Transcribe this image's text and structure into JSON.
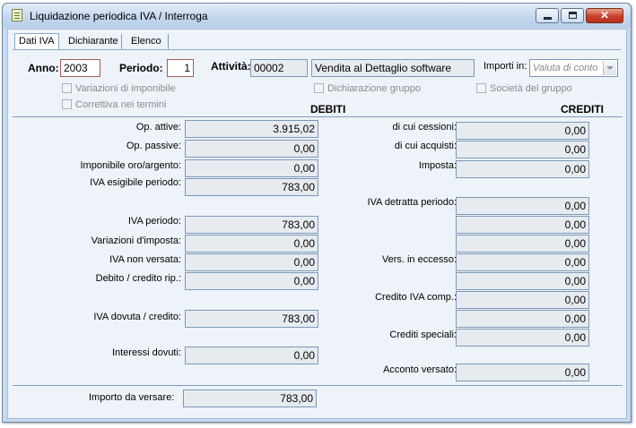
{
  "window": {
    "title": "Liquidazione periodica IVA / Interroga",
    "icon": "document-list-icon",
    "buttons": [
      "minimize",
      "maximize",
      "close"
    ]
  },
  "tabs": [
    "Dati IVA",
    "Dichiarante",
    "Elenco"
  ],
  "header": {
    "anno_label": "Anno:",
    "anno_value": "2003",
    "periodo_label": "Periodo:",
    "periodo_value": "1",
    "attivita_label": "Attività:",
    "attivita_code": "00002",
    "attivita_desc": "Vendita al Dettaglio software",
    "importi_label": "Importi in:",
    "importi_value": "Valuta di conto"
  },
  "checkboxes": {
    "variazioni_imponibile": "Variazioni di imponibile",
    "correttiva": "Correttiva nei termini",
    "dichiarazione_gruppo": "Dichiarazione gruppo",
    "societa_gruppo": "Società del gruppo"
  },
  "columns": {
    "debiti": "DEBITI",
    "crediti": "CREDITI"
  },
  "left": {
    "op_attive_label": "Op. attive:",
    "op_attive_value": "3.915,02",
    "op_passive_label": "Op. passive:",
    "op_passive_value": "0,00",
    "imponibile_oro_label": "Imponibile oro/argento:",
    "imponibile_oro_value": "0,00",
    "iva_esigibile_label": "IVA esigibile periodo:",
    "iva_esigibile_value": "783,00",
    "iva_periodo_label": "IVA periodo:",
    "iva_periodo_value": "783,00",
    "variazioni_imposta_label": "Variazioni d'imposta:",
    "variazioni_imposta_value": "0,00",
    "iva_non_versata_label": "IVA non versata:",
    "iva_non_versata_value": "0,00",
    "debito_credito_label": "Debito / credito rip.:",
    "debito_credito_value": "0,00",
    "iva_dovuta_label": "IVA dovuta / credito:",
    "iva_dovuta_value": "783,00",
    "interessi_label": "Interessi dovuti:",
    "interessi_value": "0,00"
  },
  "right": {
    "cessioni_label": "di cui cessioni:",
    "cessioni_value": "0,00",
    "acquisti_label": "di cui acquisti:",
    "acquisti_value": "0,00",
    "imposta_label": "Imposta:",
    "imposta_value": "0,00",
    "iva_detratta_label": "IVA detratta periodo:",
    "iva_detratta_value": "0,00",
    "extra1_value": "0,00",
    "extra2_value": "0,00",
    "vers_eccesso_label": "Vers. in eccesso:",
    "vers_eccesso_value": "0,00",
    "extra3_value": "0,00",
    "credito_comp_label": "Credito IVA comp.:",
    "credito_comp_value": "0,00",
    "extra4_value": "0,00",
    "crediti_speciali_label": "Crediti speciali:",
    "crediti_speciali_value": "0,00",
    "acconto_label": "Acconto versato:",
    "acconto_value": "0,00"
  },
  "footer": {
    "importo_label": "Importo da versare:",
    "importo_value": "783,00"
  }
}
